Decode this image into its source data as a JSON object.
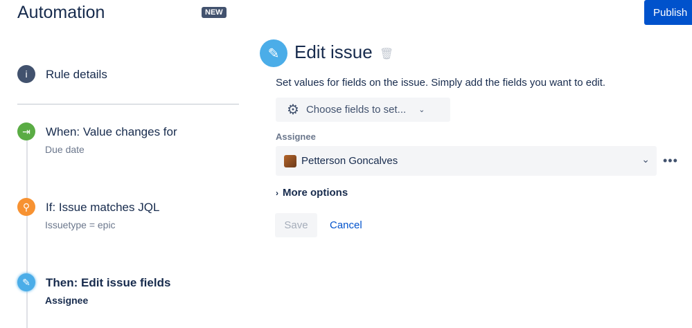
{
  "header": {
    "title": "Automation",
    "badge": "NEW",
    "publish": "Publish"
  },
  "sidebar": {
    "rule_details": "Rule details",
    "steps": [
      {
        "title": "When: Value changes for",
        "sub": "Due date",
        "color": "#5aac44"
      },
      {
        "title": "If: Issue matches JQL",
        "sub": "Issuetype = epic",
        "color": "#f79232"
      },
      {
        "title": "Then: Edit issue fields",
        "sub": "Assignee",
        "color": "#4bade8"
      }
    ]
  },
  "main": {
    "title": "Edit issue",
    "description": "Set values for fields on the issue. Simply add the fields you want to edit.",
    "choose_fields": "Choose fields to set...",
    "assignee_label": "Assignee",
    "assignee_value": "Petterson Goncalves",
    "more_options": "More options",
    "save": "Save",
    "cancel": "Cancel"
  }
}
